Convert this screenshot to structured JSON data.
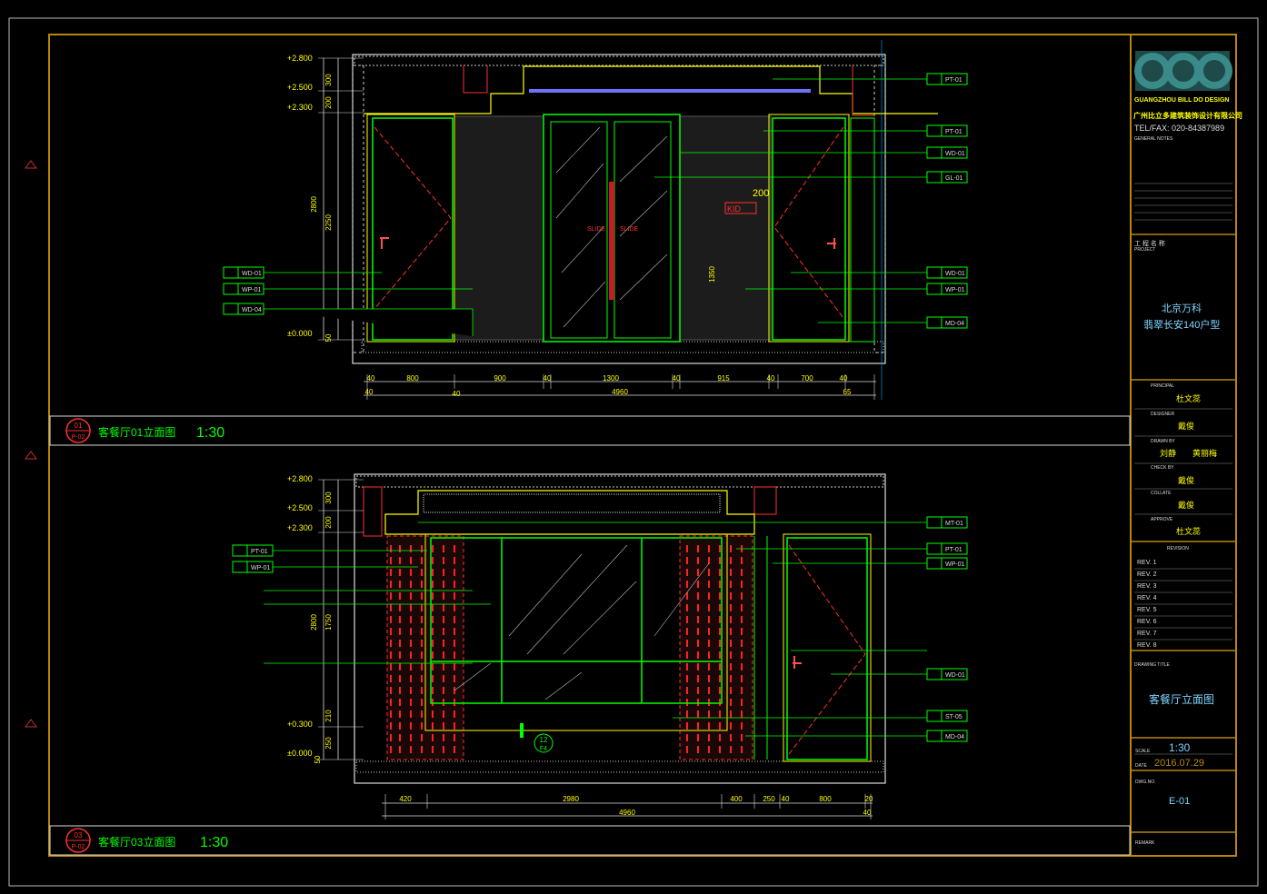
{
  "title_block": {
    "logo_text": "DBD",
    "company_en": "GUANGZHOU BILL DO DESIGN",
    "company_cn": "广州比立多建筑装饰设计有限公司",
    "tel": "TEL/FAX: 020-84387989",
    "general_notes_label": "GENERAL NOTES",
    "project_label_cn": "工 程 名 称",
    "project_label_en": "PROJECT",
    "project_name_1": "北京万科",
    "project_name_2": "翡翠长安140户型",
    "principal_label": "PRINCIPAL",
    "principal_name": "杜文蕊",
    "designer_label": "DESIGNER",
    "designer_name": "戴俊",
    "drawn_label": "DRAWN BY",
    "drawn_name_1": "刘静",
    "drawn_name_2": "黄丽梅",
    "check_label": "CHECK BY",
    "check_name": "戴俊",
    "collate_label": "COLLATE",
    "collate_name": "戴俊",
    "approve_label": "APPROVE",
    "approve_name": "杜文蕊",
    "revision_label": "REVISION",
    "revisions": [
      "REV. 1",
      "REV. 2",
      "REV. 3",
      "REV. 4",
      "REV. 5",
      "REV. 6",
      "REV. 7",
      "REV. 8"
    ],
    "drawing_title_label": "DRAWING TITLE",
    "drawing_title": "客餐厅立面图",
    "scale_label": "SCALE",
    "scale_value": "1:30",
    "date_label": "DATE",
    "date_value": "2016.07.29",
    "drawing_no_label": "DWG.NO.",
    "drawing_no": "E-01",
    "remark_label": "REMARK"
  },
  "view_top": {
    "num": "01",
    "sheet": "P-02",
    "title": "客餐厅01立面图",
    "scale": "1:30",
    "levels": [
      "+2.800",
      "+2.500",
      "+2.300",
      "±0.000"
    ],
    "vdims": [
      "300",
      "200",
      "2800",
      "2250",
      "1350",
      "50"
    ],
    "hdims": [
      "40",
      "800",
      "900",
      "40",
      "1300",
      "40",
      "915",
      "40",
      "700",
      "40"
    ],
    "hdims2": [
      "40",
      "40",
      "4960",
      "65"
    ],
    "tags_right": [
      "PT-01",
      "PT-01",
      "WD-01",
      "GL-01",
      "WD-01",
      "WP-01",
      "MD-04"
    ],
    "tags_left": [
      "WD-01",
      "WP-01",
      "WD-04"
    ],
    "door_text_l": "SLIDE",
    "door_text_r": "SLIDE",
    "dim_200": "200",
    "kid_text": "KID"
  },
  "view_bottom": {
    "num": "03",
    "sheet": "P-02",
    "title": "客餐厅03立面图",
    "scale": "1:30",
    "levels": [
      "+2.800",
      "+2.500",
      "+2.300",
      "+0.300",
      "±0.000"
    ],
    "vdims": [
      "300",
      "200",
      "2800",
      "1750",
      "210",
      "250",
      "50"
    ],
    "hdims": [
      "420",
      "2980",
      "400",
      "250",
      "40",
      "800",
      "20"
    ],
    "hdims2": [
      "4960",
      "40"
    ],
    "tags_right": [
      "MT-01",
      "PT-01",
      "WP-01",
      "WD-01",
      "ST-05",
      "MD-04"
    ],
    "tags_left": [
      "PT-01",
      "WP-01"
    ],
    "section_num": "12",
    "section_sheet": "F4"
  }
}
